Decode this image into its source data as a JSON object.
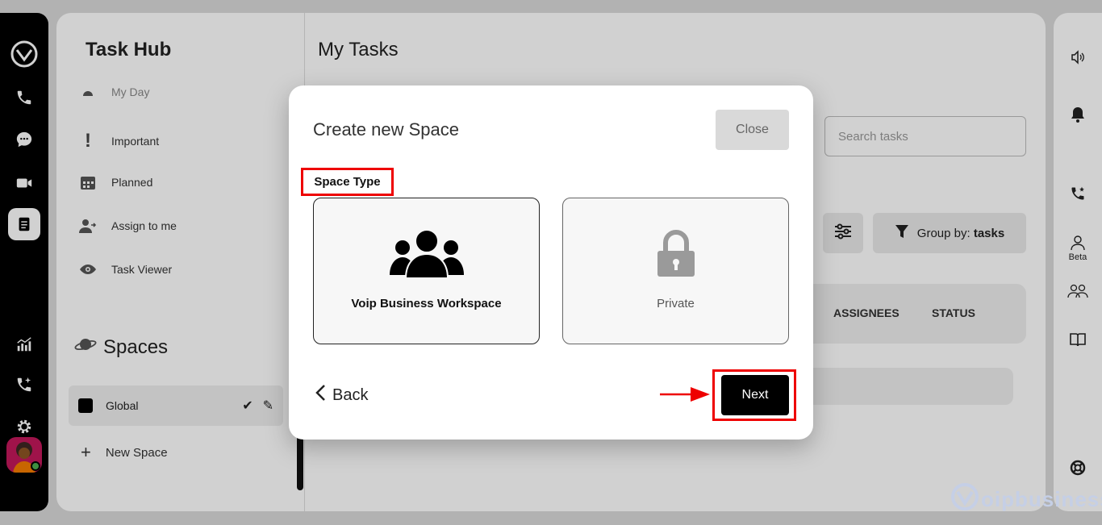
{
  "left_rail": {
    "icons": [
      "app-logo-icon",
      "phone-icon",
      "chat-icon",
      "video-icon",
      "tasks-icon",
      "analytics-icon",
      "call-sparkle-icon",
      "settings-icon"
    ],
    "avatar": "user-avatar"
  },
  "sidebar": {
    "title": "Task Hub",
    "items": [
      {
        "label": "My Day",
        "icon": "sun-icon"
      },
      {
        "label": "Important",
        "icon": "exclamation-icon"
      },
      {
        "label": "Planned",
        "icon": "calendar-icon"
      },
      {
        "label": "Assign to me",
        "icon": "user-assign-icon"
      },
      {
        "label": "Task Viewer",
        "icon": "eye-icon"
      }
    ],
    "spaces_title": "Spaces",
    "spaces": [
      {
        "label": "Global",
        "color": "#000000"
      }
    ],
    "new_space_label": "New Space"
  },
  "content": {
    "title": "My Tasks",
    "search_placeholder": "Search tasks",
    "group_by_prefix": "Group by: ",
    "group_by_value": "tasks",
    "columns": [
      "ASSIGNEES",
      "STATUS"
    ]
  },
  "right_rail": {
    "icons": [
      "speaker-icon",
      "bell-icon",
      "call-star-icon",
      "user-icon",
      "users-icon",
      "book-icon",
      "lifebuoy-icon"
    ],
    "beta_label": "Beta"
  },
  "watermark": {
    "text": "oipbusiness"
  },
  "modal": {
    "title": "Create new Space",
    "close_label": "Close",
    "space_type_label": "Space Type",
    "options": [
      {
        "label": "Voip Business Workspace",
        "icon": "group-icon"
      },
      {
        "label": "Private",
        "icon": "lock-icon"
      }
    ],
    "back_label": "Back",
    "next_label": "Next"
  },
  "colors": {
    "highlight": "#e00000",
    "primary": "#000000"
  }
}
